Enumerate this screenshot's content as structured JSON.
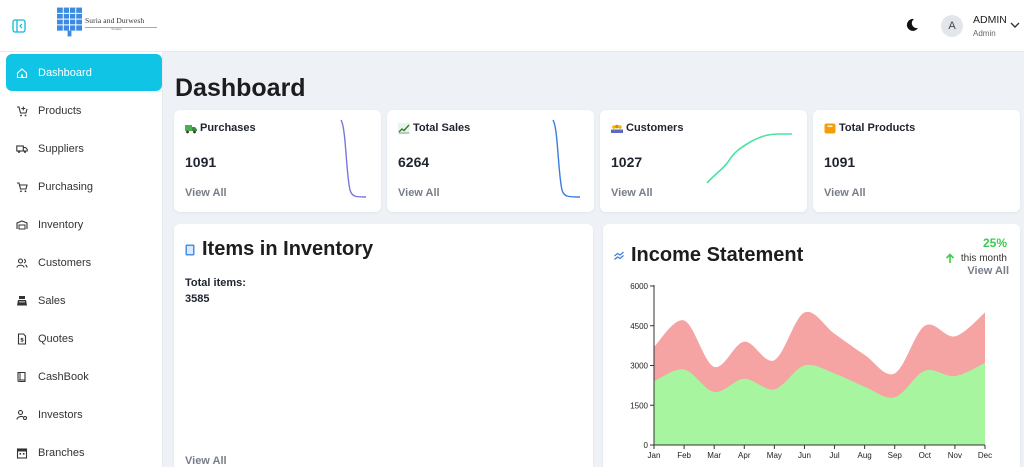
{
  "brand": {
    "name": "Suria and Durwesh",
    "tagline": "Traders"
  },
  "user": {
    "initial": "A",
    "name": "ADMIN",
    "role": "Admin"
  },
  "sidebar": {
    "items": [
      {
        "label": "Dashboard",
        "icon": "home-icon",
        "active": true
      },
      {
        "label": "Products",
        "icon": "cart-plus-icon"
      },
      {
        "label": "Suppliers",
        "icon": "truck-icon"
      },
      {
        "label": "Purchasing",
        "icon": "shopping-cart-icon"
      },
      {
        "label": "Inventory",
        "icon": "warehouse-icon"
      },
      {
        "label": "Customers",
        "icon": "users-icon"
      },
      {
        "label": "Sales",
        "icon": "cash-register-icon"
      },
      {
        "label": "Quotes",
        "icon": "file-dollar-icon"
      },
      {
        "label": "CashBook",
        "icon": "book-icon"
      },
      {
        "label": "Investors",
        "icon": "user-cog-icon"
      },
      {
        "label": "Branches",
        "icon": "building-icon"
      }
    ]
  },
  "page": {
    "title": "Dashboard"
  },
  "stats": [
    {
      "title": "Purchases",
      "value": "1091",
      "link": "View All",
      "icon": "truck-emoji-icon"
    },
    {
      "title": "Total Sales",
      "value": "6264",
      "link": "View All",
      "icon": "chart-up-emoji-icon"
    },
    {
      "title": "Customers",
      "value": "1027",
      "link": "View All",
      "icon": "crowd-emoji-icon"
    },
    {
      "title": "Total Products",
      "value": "1091",
      "link": "View All",
      "icon": "box-emoji-icon"
    }
  ],
  "inventory": {
    "title": "Items in Inventory",
    "total_label": "Total items:",
    "total_value": "3585",
    "link": "View All",
    "icon": "book-emoji-icon"
  },
  "income": {
    "title": "Income Statement",
    "change": "25%",
    "period": "this month",
    "link": "View All",
    "icon": "chart-emoji-icon",
    "accent": "#3ccc4e"
  },
  "chart_data": {
    "type": "area",
    "categories": [
      "Jan",
      "Feb",
      "Mar",
      "Apr",
      "May",
      "Jun",
      "Jul",
      "Aug",
      "Sep",
      "Oct",
      "Nov",
      "Dec"
    ],
    "ylim": [
      0,
      6000
    ],
    "yticks": [
      0,
      1500,
      3000,
      4500,
      6000
    ],
    "grid": false,
    "series": [
      {
        "values": [
          2400,
          2850,
          2000,
          2500,
          2100,
          3000,
          2700,
          2200,
          1800,
          2800,
          2600,
          3100
        ],
        "color": "#a8f5a0"
      },
      {
        "values": [
          3700,
          4700,
          2950,
          3900,
          3200,
          5000,
          4200,
          3400,
          2700,
          4500,
          4100,
          5000
        ],
        "color": "#f5a3a3"
      }
    ]
  }
}
